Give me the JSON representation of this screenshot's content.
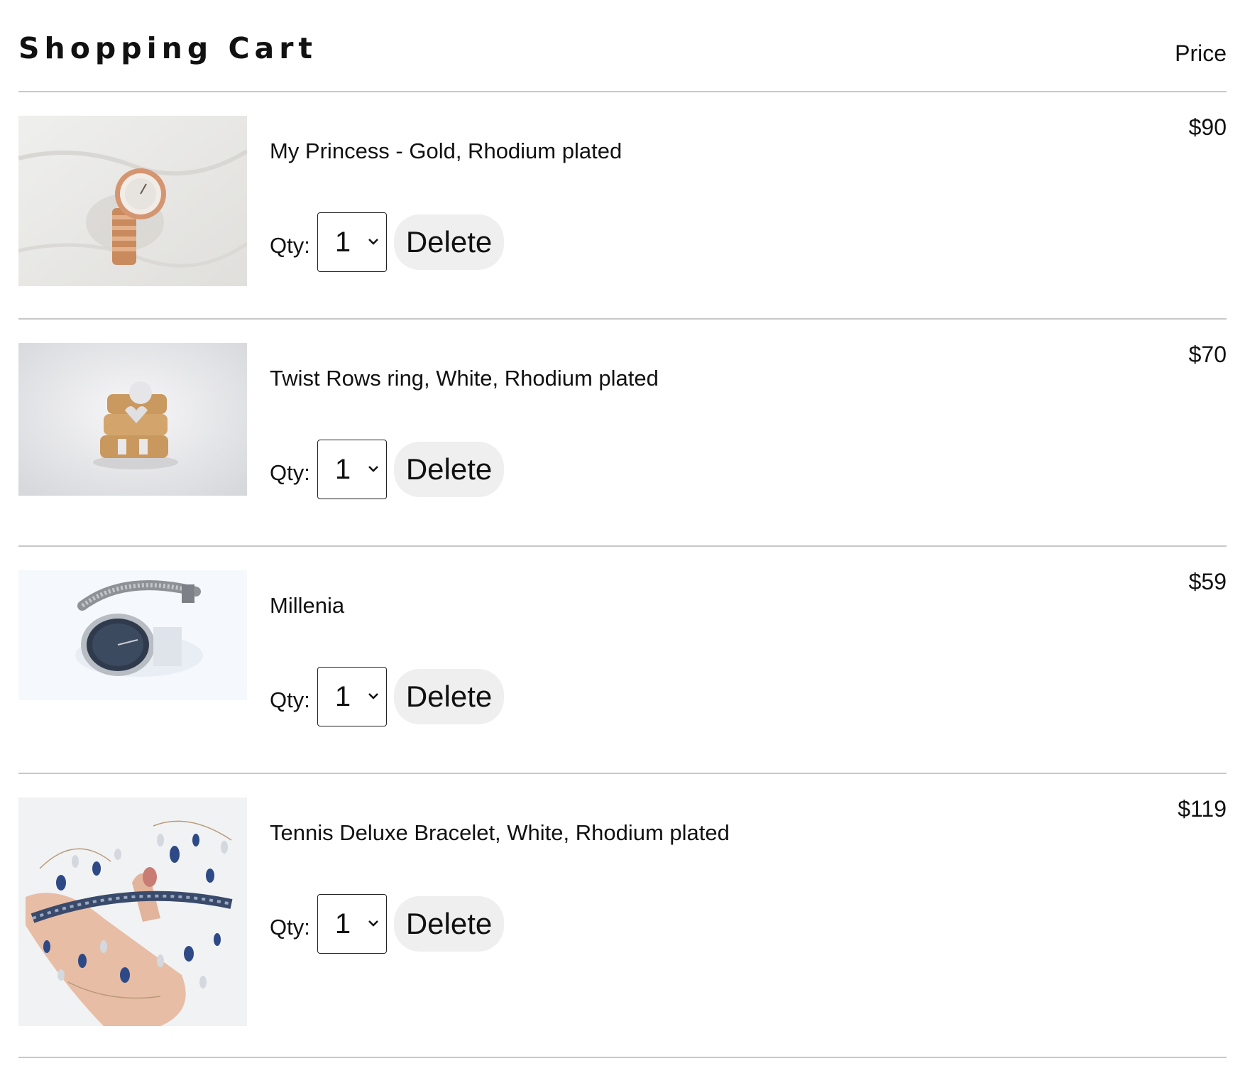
{
  "cart": {
    "title": "Shopping Cart",
    "price_heading": "Price",
    "qty_label": "Qty:",
    "delete_label": "Delete",
    "items": [
      {
        "name": "My Princess - Gold, Rhodium plated",
        "price": "$90",
        "qty": "1",
        "image": "rose-gold-wristwatch"
      },
      {
        "name": "Twist Rows ring, White, Rhodium plated",
        "price": "$70",
        "qty": "1",
        "image": "stacked-gold-rings"
      },
      {
        "name": "Millenia",
        "price": "$59",
        "qty": "1",
        "image": "silver-mesh-watch"
      },
      {
        "name": "Tennis Deluxe Bracelet, White, Rhodium plated",
        "price": "$119",
        "qty": "1",
        "image": "crystal-tiara-on-hand"
      }
    ]
  }
}
